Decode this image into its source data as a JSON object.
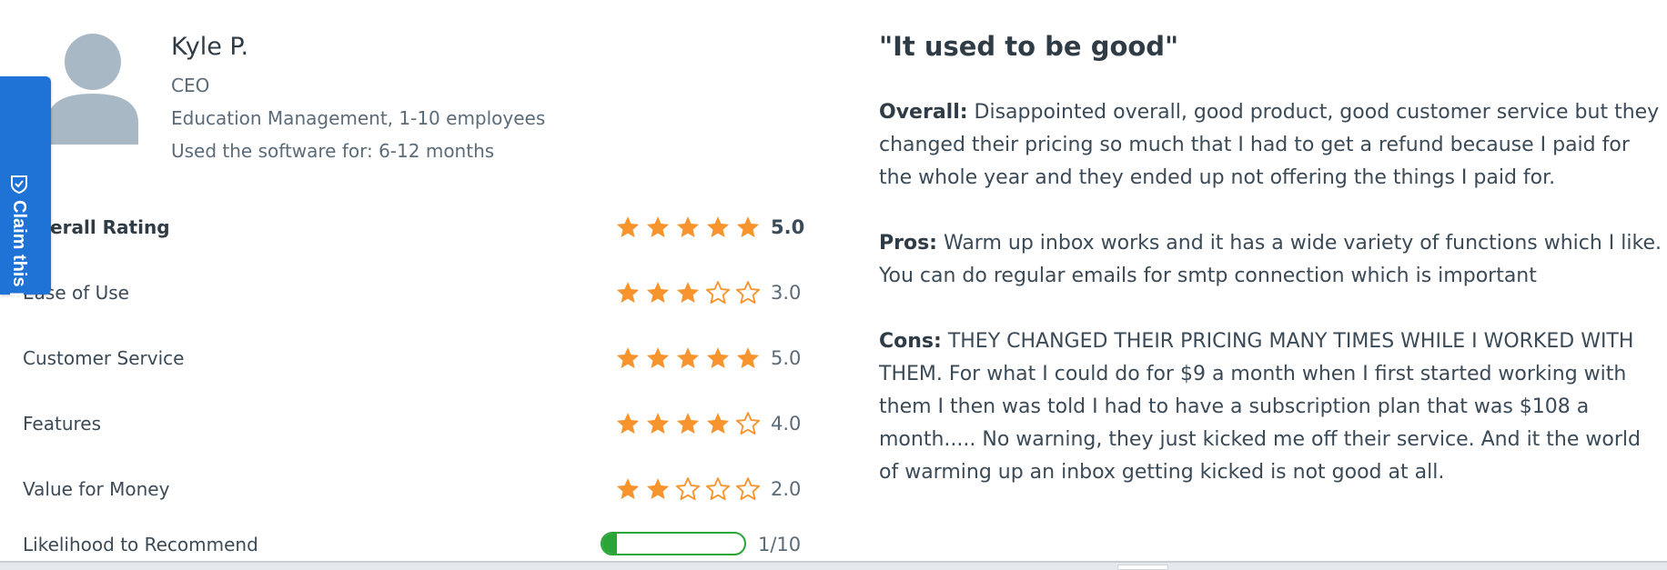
{
  "reviewer": {
    "name": "Kyle P.",
    "title": "CEO",
    "company": "Education Management, 1-10 employees",
    "usage": "Used the software for: 6-12 months",
    "avatar_icon": "user-silhouette-icon"
  },
  "claim_tab": {
    "label": "Claim this profile",
    "icon": "shield-check-icon",
    "color": "#1f72d6"
  },
  "ratings": [
    {
      "label": "Overall Rating",
      "stars": 5,
      "value": "5.0"
    },
    {
      "label": "Ease of Use",
      "stars": 3,
      "value": "3.0"
    },
    {
      "label": "Customer Service",
      "stars": 5,
      "value": "5.0"
    },
    {
      "label": "Features",
      "stars": 4,
      "value": "4.0"
    },
    {
      "label": "Value for Money",
      "stars": 2,
      "value": "2.0"
    }
  ],
  "recommendation": {
    "label": "Likelihood to Recommend",
    "value": "1/10",
    "fraction": 0.1
  },
  "review": {
    "title": "\"It used to be good\"",
    "overall_label": "Overall:",
    "overall_text": "Disappointed overall, good product, good customer service but they changed their pricing so much that I had to get a refund because I paid for the whole year and they ended up not offering the things I paid for.",
    "pros_label": "Pros:",
    "pros_text": "Warm up inbox works and it has a wide variety of functions which I like. You can do regular emails for smtp connection which is important",
    "cons_label": "Cons:",
    "cons_text": "THEY CHANGED THEIR PRICING MANY TIMES WHILE I WORKED WITH THEM. For what I could do for $9 a month when I first started working with them I then was told I had to have a subscription plan that was $108 a month..... No warning, they just kicked me off their service. And it the world of warming up an inbox getting kicked is not good at all."
  },
  "colors": {
    "star": "#f7942d",
    "progress": "#2aa537",
    "avatar": "#a8b8c4"
  }
}
